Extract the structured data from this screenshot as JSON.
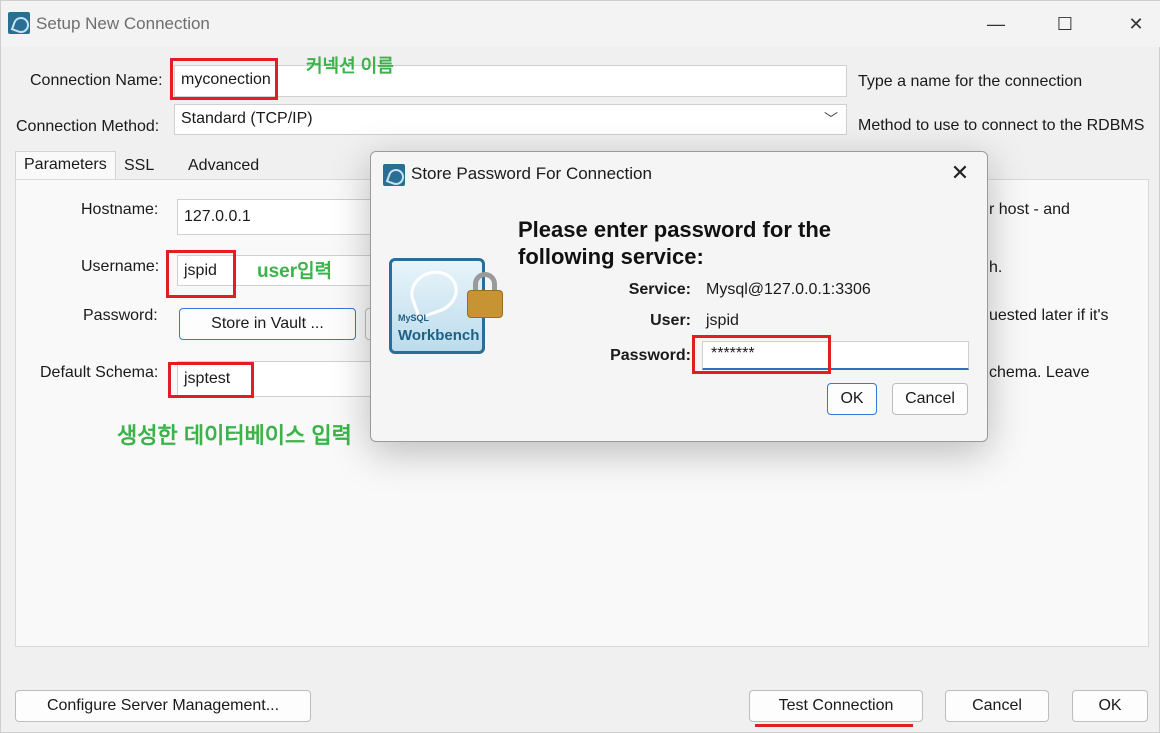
{
  "window": {
    "title": "Setup New Connection",
    "controls": {
      "minimize": "—",
      "maximize": "☐",
      "close": "✕"
    }
  },
  "form": {
    "connection_name_label": "Connection Name:",
    "connection_name_value": "myconection",
    "connection_name_desc": "Type a name for the connection",
    "connection_method_label": "Connection Method:",
    "connection_method_value": "Standard (TCP/IP)",
    "connection_method_desc": "Method to use to connect to the RDBMS"
  },
  "tabs": [
    {
      "label": "Parameters",
      "active": true
    },
    {
      "label": "SSL",
      "active": false
    },
    {
      "label": "Advanced",
      "active": false
    }
  ],
  "parameters": {
    "hostname_label": "Hostname:",
    "hostname_value": "127.0.0.1",
    "hostname_desc_fragment": "r host - and",
    "username_label": "Username:",
    "username_value": "jspid",
    "username_desc_fragment": "h.",
    "password_label": "Password:",
    "store_in_vault_label": "Store in Vault ...",
    "password_desc_fragment": "uested later if it's",
    "default_schema_label": "Default Schema:",
    "default_schema_value": "jsptest",
    "default_schema_desc_fragment": "chema. Leave"
  },
  "annotations": {
    "connection_name_note": "커넥션 이름",
    "username_note": "user입력",
    "schema_note": "생성한 데이터베이스 입력"
  },
  "footer": {
    "configure_label": "Configure Server Management...",
    "test_connection_label": "Test Connection",
    "cancel_label": "Cancel",
    "ok_label": "OK"
  },
  "dialog": {
    "title": "Store Password For Connection",
    "close": "✕",
    "heading": "Please enter password for the following service:",
    "service_label": "Service:",
    "service_value": "Mysql@127.0.0.1:3306",
    "user_label": "User:",
    "user_value": "jspid",
    "password_label": "Password:",
    "password_value": "*******",
    "ok_label": "OK",
    "cancel_label": "Cancel",
    "logo_text": "Workbench",
    "logo_brand": "MySQL"
  },
  "colors": {
    "highlight_red": "#e31d24",
    "note_green": "#3cb34a",
    "focus_blue": "#2f7bd6"
  }
}
